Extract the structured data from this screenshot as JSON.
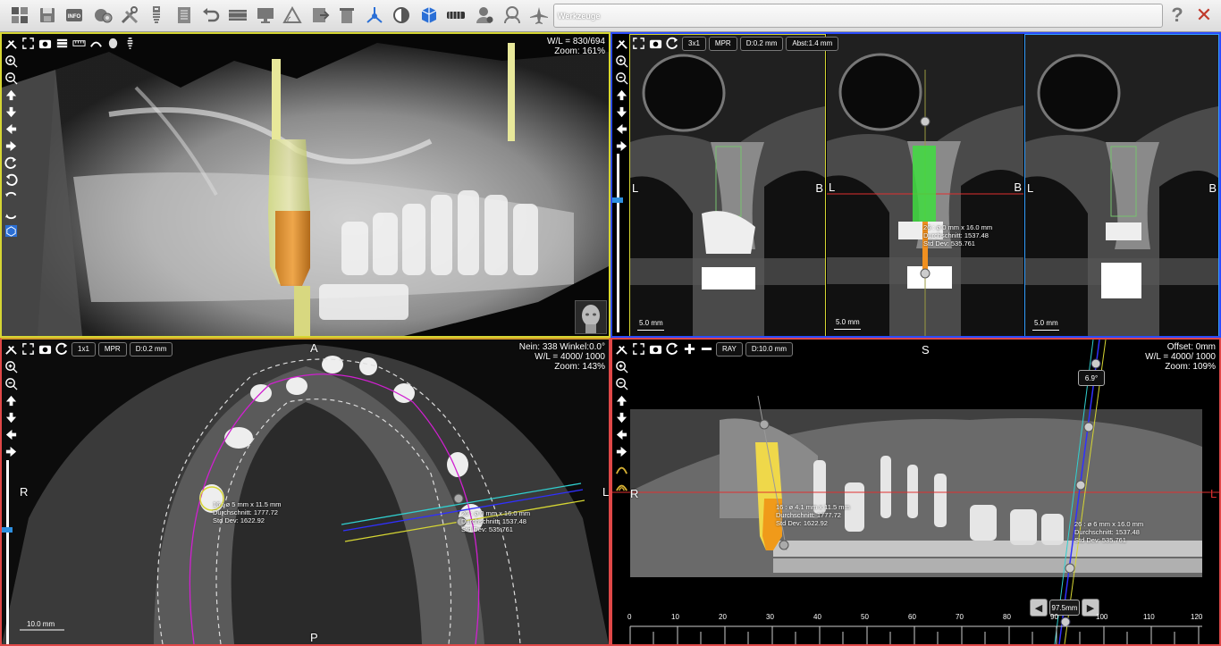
{
  "toolbar": {
    "title_field": "Werkzeuge",
    "help_label": "?",
    "close_label": "✕",
    "info_label": "INFO",
    "accent": "#2a6fd6",
    "icons": [
      "layout-icon",
      "save-icon",
      "info-icon",
      "settings-icon",
      "tools-icon",
      "implant-icon",
      "report-icon",
      "undo-icon",
      "panorama-icon",
      "screen-icon",
      "measure-angle-icon",
      "export-icon",
      "delete-icon",
      "axes-icon",
      "contrast-icon",
      "3d-icon",
      "jaw-icon",
      "user-settings-icon",
      "patient-icon",
      "airway-icon"
    ]
  },
  "panoramic": {
    "wl": "W/L = 830/694",
    "zoom": "Zoom: 161%"
  },
  "cross": {
    "layout_chip": "3x1",
    "mode_chip": "MPR",
    "thickness_chip": "D:0.2 mm",
    "spacing_chip": "Abst:1.4 mm",
    "left_label": "L",
    "right_label": "B",
    "scale_label": "5.0 mm",
    "measure": [
      "26 : ø 0 mm x 16.0 mm",
      "Durchschnitt: 1537.48",
      "Std Dev: 535.761"
    ]
  },
  "axial": {
    "layout_chip": "1x1",
    "mode_chip": "MPR",
    "thickness_chip": "D:0.2 mm",
    "tilt": "Nein: 338 Winkel:0.0°",
    "wl": "W/L = 4000/ 1000",
    "zoom": "Zoom: 143%",
    "top_label": "A",
    "bottom_label": "P",
    "left_label": "R",
    "right_label": "L",
    "scale_label": "10.0 mm",
    "measure_16": [
      "16 : ø 5 mm x 11.5 mm",
      "Durchschnitt: 1777.72",
      "Std Dev: 1622.92"
    ],
    "measure_26": [
      "26 : ø 0 mm x 16.0 mm",
      "Durchschnitt: 1537.48",
      "Std Dev: 535.761"
    ]
  },
  "sagittal": {
    "mode_chip": "RAY",
    "thickness_chip": "D:10.0 mm",
    "offset": "Offset: 0mm",
    "wl": "W/L = 4000/ 1000",
    "zoom": "Zoom: 109%",
    "top_label": "S",
    "left_label": "R",
    "right_label": "L",
    "angle": "6.9°",
    "distance": "97.5mm",
    "measure_16": [
      "16 : ø 4.1 mm x 11.5 mm",
      "Durchschnitt: 1777.72",
      "Std Dev: 1622.92"
    ],
    "measure_26": [
      "26 : ø 6 mm x 16.0 mm",
      "Durchschnitt: 1537.48",
      "Std Dev: 535.761"
    ],
    "ruler_labels": [
      "0",
      "10",
      "20",
      "30",
      "40",
      "50",
      "60",
      "70",
      "80",
      "90",
      "100",
      "110",
      "120"
    ]
  }
}
